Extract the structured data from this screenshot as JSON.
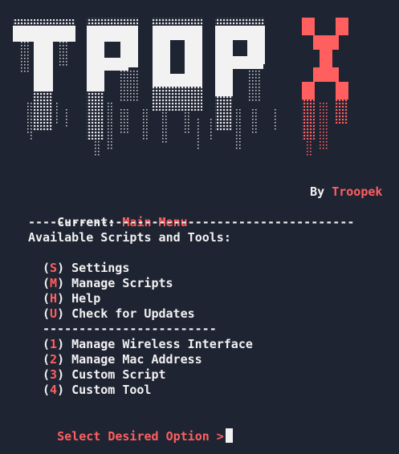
{
  "banner": {
    "logo_text": "TROPX",
    "tagline_prefix": "By",
    "author": "Troopek"
  },
  "colors": {
    "background": "#1f2433",
    "text": "#f2f2f2",
    "accent": "#ff5f5f"
  },
  "status": {
    "label": "Current:",
    "value": "Main Menu"
  },
  "separator_long": "---------------------------------------------",
  "section_title": "Available Scripts and Tools:",
  "menu_letters": [
    {
      "key": "S",
      "label": "Settings"
    },
    {
      "key": "M",
      "label": "Manage Scripts"
    },
    {
      "key": "H",
      "label": "Help"
    },
    {
      "key": "U",
      "label": "Check for Updates"
    }
  ],
  "separator_short": "------------------------",
  "menu_numbers": [
    {
      "key": "1",
      "label": "Manage Wireless Interface"
    },
    {
      "key": "2",
      "label": "Manage Mac Address"
    },
    {
      "key": "3",
      "label": "Custom Script"
    },
    {
      "key": "4",
      "label": "Custom Tool"
    }
  ],
  "prompt": {
    "text": "Select Desired Option >"
  }
}
